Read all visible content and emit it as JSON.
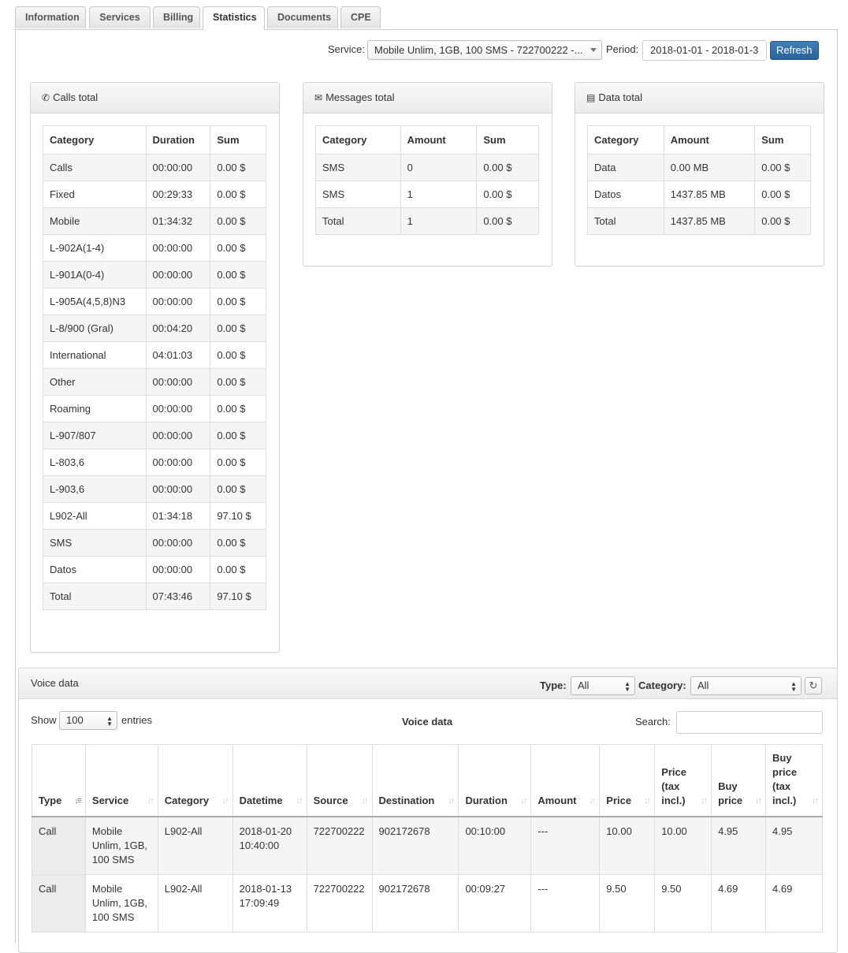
{
  "tabs": [
    "Information",
    "Services",
    "Billing",
    "Statistics",
    "Documents",
    "CPE"
  ],
  "active_tab": "Statistics",
  "filters": {
    "service_label": "Service:",
    "service_value": "Mobile Unlim, 1GB, 100 SMS - 722700222 -...",
    "period_label": "Period:",
    "period_value": "2018-01-01 - 2018-01-3",
    "refresh_label": "Refresh"
  },
  "calls_total": {
    "title": "Calls total",
    "columns": [
      "Category",
      "Duration",
      "Sum"
    ],
    "rows": [
      [
        "Calls",
        "00:00:00",
        "0.00 $"
      ],
      [
        "Fixed",
        "00:29:33",
        "0.00 $"
      ],
      [
        "Mobile",
        "01:34:32",
        "0.00 $"
      ],
      [
        "L-902A(1-4)",
        "00:00:00",
        "0.00 $"
      ],
      [
        "L-901A(0-4)",
        "00:00:00",
        "0.00 $"
      ],
      [
        "L-905A(4,5,8)N3",
        "00:00:00",
        "0.00 $"
      ],
      [
        "L-8/900 (Gral)",
        "00:04:20",
        "0.00 $"
      ],
      [
        "International",
        "04:01:03",
        "0.00 $"
      ],
      [
        "Other",
        "00:00:00",
        "0.00 $"
      ],
      [
        "Roaming",
        "00:00:00",
        "0.00 $"
      ],
      [
        "L-907/807",
        "00:00:00",
        "0.00 $"
      ],
      [
        "L-803,6",
        "00:00:00",
        "0.00 $"
      ],
      [
        "L-903,6",
        "00:00:00",
        "0.00 $"
      ],
      [
        "L902-All",
        "01:34:18",
        "97.10 $"
      ],
      [
        "SMS",
        "00:00:00",
        "0.00 $"
      ],
      [
        "Datos",
        "00:00:00",
        "0.00 $"
      ],
      [
        "Total",
        "07:43:46",
        "97.10 $"
      ]
    ]
  },
  "messages_total": {
    "title": "Messages total",
    "columns": [
      "Category",
      "Amount",
      "Sum"
    ],
    "rows": [
      [
        "SMS",
        "0",
        "0.00 $"
      ],
      [
        "SMS",
        "1",
        "0.00 $"
      ],
      [
        "Total",
        "1",
        "0.00 $"
      ]
    ]
  },
  "data_total": {
    "title": "Data total",
    "columns": [
      "Category",
      "Amount",
      "Sum"
    ],
    "rows": [
      [
        "Data",
        "0.00 MB",
        "0.00 $"
      ],
      [
        "Datos",
        "1437.85 MB",
        "0.00 $"
      ],
      [
        "Total",
        "1437.85 MB",
        "0.00 $"
      ]
    ]
  },
  "voice_data": {
    "panel_title": "Voice data",
    "type_label": "Type:",
    "type_value": "All",
    "category_label": "Category:",
    "category_value": "All",
    "show_label": "Show",
    "show_value": "100",
    "entries_label": "entries",
    "table_title": "Voice data",
    "search_label": "Search:",
    "columns": [
      "Type",
      "Service",
      "Category",
      "Datetime",
      "Source",
      "Destination",
      "Duration",
      "Amount",
      "Price",
      "Price (tax incl.)",
      "Buy price",
      "Buy price (tax incl.)"
    ],
    "rows": [
      [
        "Call",
        "Mobile Unlim, 1GB, 100 SMS",
        "L902-All",
        "2018-01-20 10:40:00",
        "722700222",
        "902172678",
        "00:10:00",
        "---",
        "10.00",
        "10.00",
        "4.95",
        "4.95"
      ],
      [
        "Call",
        "Mobile Unlim, 1GB, 100 SMS",
        "L902-All",
        "2018-01-13 17:09:49",
        "722700222",
        "902172678",
        "00:09:27",
        "---",
        "9.50",
        "9.50",
        "4.69",
        "4.69"
      ]
    ]
  }
}
